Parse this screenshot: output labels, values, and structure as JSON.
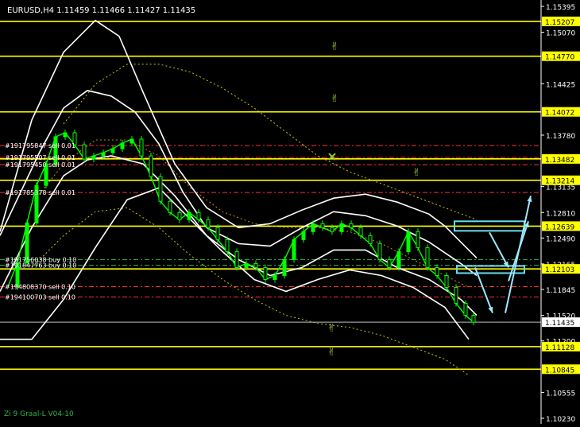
{
  "header": {
    "title": "EURUSD,H4  1.11459 1.11466 1.11427 1.11435"
  },
  "footer": {
    "indicator_label": "Zi 9 Graal-L V04-10"
  },
  "colors": {
    "background": "#000000",
    "candle_up": "#00ff00",
    "level_line": "#ffff00",
    "band": "#ffffff",
    "dotted_ma": "#c8c800",
    "order_line": "#ff3030",
    "buy_order_line": "#2fb34a",
    "bid_line": "#c0c0c0",
    "arrow": "#9fe8ff",
    "target_box": "#66ddee",
    "thumb": "#9acd32",
    "cross": "#9acd32"
  },
  "chart_data": {
    "type": "line",
    "symbol": "EURUSD",
    "timeframe": "H4",
    "ohlc": {
      "open": 1.11459,
      "high": 1.11466,
      "low": 1.11427,
      "close": 1.11435
    },
    "ylim": [
      1.1023,
      1.15395
    ],
    "y_ticks": [
      1.15395,
      1.1507,
      1.14425,
      1.1378,
      1.13135,
      1.1281,
      1.1249,
      1.12165,
      1.11845,
      1.1152,
      1.112,
      1.10555,
      1.1023
    ],
    "bid_price": 1.11435,
    "levels": [
      1.15207,
      1.1477,
      1.14072,
      1.13482,
      1.13214,
      1.12639,
      1.12103,
      1.11128,
      1.10845
    ],
    "level_labels": [
      "1.15207",
      "1.14770",
      "1.14072",
      "1.13482",
      "1.13214",
      "1.12639",
      "1.12103",
      "1.11128",
      "1.10845"
    ],
    "orders": [
      {
        "label": "#191795847 sell 0.01",
        "price": 1.1365,
        "side": "sell"
      },
      {
        "label": "#191795507 sell 0.01",
        "price": 1.135,
        "side": "sell"
      },
      {
        "label": "#191795450 sell 0.01",
        "price": 1.1341,
        "side": "sell"
      },
      {
        "label": "#191785378 sell 0.01",
        "price": 1.1306,
        "side": "sell"
      },
      {
        "label": "#191756038 buy 0.10",
        "price": 1.1222,
        "side": "buy"
      },
      {
        "label": "#191847763 buy 0.10",
        "price": 1.1215,
        "side": "buy"
      },
      {
        "label": "#194808370 sell 0.10",
        "price": 1.1188,
        "side": "sell"
      },
      {
        "label": "#194100703 sell 0.10",
        "price": 1.1175,
        "side": "sell"
      }
    ],
    "close_series": {
      "x": [
        10,
        22,
        34,
        46,
        58,
        70,
        82,
        94,
        106,
        118,
        130,
        142,
        154,
        166,
        178,
        190,
        202,
        214,
        226,
        238,
        250,
        262,
        274,
        286,
        298,
        310,
        322,
        334,
        346,
        358,
        370,
        382,
        394,
        406,
        418,
        430,
        442,
        454,
        466,
        478,
        490,
        502,
        514,
        526,
        538,
        550,
        562,
        574,
        586,
        596
      ],
      "values": [
        1.1188,
        1.1218,
        1.1268,
        1.1315,
        1.1342,
        1.1376,
        1.1381,
        1.1366,
        1.1348,
        1.1352,
        1.1356,
        1.1361,
        1.1368,
        1.1373,
        1.1352,
        1.1326,
        1.1295,
        1.1281,
        1.1272,
        1.1281,
        1.1272,
        1.1262,
        1.1247,
        1.1232,
        1.1212,
        1.1217,
        1.1212,
        1.1197,
        1.1202,
        1.1222,
        1.1247,
        1.1257,
        1.1267,
        1.1262,
        1.1257,
        1.1267,
        1.1262,
        1.1252,
        1.1242,
        1.1222,
        1.1212,
        1.1232,
        1.1257,
        1.1237,
        1.1212,
        1.1202,
        1.1187,
        1.1167,
        1.1152,
        1.11435
      ]
    },
    "bands": [
      {
        "name": "outer_upper",
        "x": [
          0,
          40,
          80,
          120,
          150,
          180,
          220,
          260,
          300,
          340,
          380,
          420,
          460,
          500,
          540,
          560,
          580,
          600
        ],
        "values": [
          1.1257,
          1.1397,
          1.1482,
          1.1522,
          1.1502,
          1.1432,
          1.1342,
          1.1287,
          1.1262,
          1.1267,
          1.1284,
          1.1299,
          1.1304,
          1.1294,
          1.1279,
          1.1264,
          1.1244,
          1.1224
        ]
      },
      {
        "name": "inner_upper",
        "x": [
          0,
          50,
          80,
          110,
          140,
          170,
          200,
          230,
          260,
          300,
          340,
          380,
          420,
          460,
          500,
          540,
          580,
          600
        ],
        "values": [
          1.1252,
          1.1357,
          1.1412,
          1.1434,
          1.1427,
          1.1407,
          1.1367,
          1.1307,
          1.1262,
          1.1242,
          1.1239,
          1.1262,
          1.1282,
          1.1277,
          1.1264,
          1.1244,
          1.1217,
          1.1202
        ]
      },
      {
        "name": "inner_lower",
        "x": [
          0,
          40,
          80,
          110,
          140,
          180,
          220,
          260,
          300,
          340,
          380,
          420,
          460,
          500,
          540,
          580,
          600
        ],
        "values": [
          1.1182,
          1.1262,
          1.1327,
          1.1347,
          1.1352,
          1.1342,
          1.1302,
          1.1252,
          1.1222,
          1.1202,
          1.1212,
          1.1234,
          1.1234,
          1.1212,
          1.1197,
          1.1172,
          1.1152
        ]
      },
      {
        "name": "outer_lower",
        "x": [
          0,
          40,
          80,
          120,
          160,
          200,
          240,
          280,
          320,
          360,
          400,
          440,
          480,
          520,
          560,
          590
        ],
        "values": [
          1.1122,
          1.1122,
          1.1172,
          1.1237,
          1.1297,
          1.1312,
          1.1272,
          1.1232,
          1.1197,
          1.1182,
          1.1197,
          1.1209,
          1.1202,
          1.1187,
          1.1162,
          1.1122
        ]
      }
    ],
    "dotted_mas": [
      {
        "name": "slow_upper",
        "x": [
          80,
          120,
          160,
          200,
          240,
          280,
          320,
          360,
          400,
          440,
          480,
          520,
          560,
          600
        ],
        "values": [
          1.1392,
          1.1442,
          1.1467,
          1.1467,
          1.1457,
          1.1437,
          1.1412,
          1.1382,
          1.1352,
          1.1332,
          1.1317,
          1.1302,
          1.1287,
          1.1272
        ]
      },
      {
        "name": "slow_lower",
        "x": [
          40,
          80,
          120,
          160,
          200,
          240,
          280,
          320,
          360,
          400,
          440,
          480,
          520,
          560,
          590
        ],
        "values": [
          1.1212,
          1.1252,
          1.1282,
          1.1287,
          1.1262,
          1.1227,
          1.1197,
          1.1172,
          1.1152,
          1.1142,
          1.1137,
          1.1127,
          1.1112,
          1.1097,
          1.1077
        ]
      },
      {
        "name": "mid_orange",
        "x": [
          40,
          80,
          120,
          160,
          200,
          240,
          280,
          320,
          360,
          400,
          440,
          480,
          520,
          560,
          590
        ],
        "values": [
          1.1292,
          1.1342,
          1.1372,
          1.1372,
          1.1352,
          1.1312,
          1.1282,
          1.1267,
          1.1262,
          1.1262,
          1.1257,
          1.1242,
          1.1222,
          1.1202,
          1.1187
        ]
      }
    ],
    "annotations": {
      "thumbs_up_at": [
        {
          "x": 422,
          "price": 1.149
        },
        {
          "x": 422,
          "price": 1.1425
        },
        {
          "x": 525,
          "price": 1.1332
        },
        {
          "x": 418,
          "price": 1.1137
        },
        {
          "x": 418,
          "price": 1.1107
        }
      ],
      "cross_at": {
        "x": 418,
        "price": 1.1351
      },
      "target_boxes": [
        {
          "x_from": 572,
          "x_to": 660,
          "price_top": 1.127,
          "price_bottom": 1.1258
        },
        {
          "x_from": 575,
          "x_to": 660,
          "price_top": 1.1214,
          "price_bottom": 1.1205
        }
      ],
      "arrows": [
        {
          "x_from": 616,
          "x_to": 640,
          "price_from": 1.1256,
          "price_to": 1.1212
        },
        {
          "x_from": 598,
          "x_to": 620,
          "price_from": 1.1212,
          "price_to": 1.1155
        },
        {
          "x_from": 640,
          "x_to": 665,
          "price_from": 1.1195,
          "price_to": 1.127
        },
        {
          "x_from": 636,
          "x_to": 668,
          "price_from": 1.1155,
          "price_to": 1.1302
        }
      ]
    }
  }
}
